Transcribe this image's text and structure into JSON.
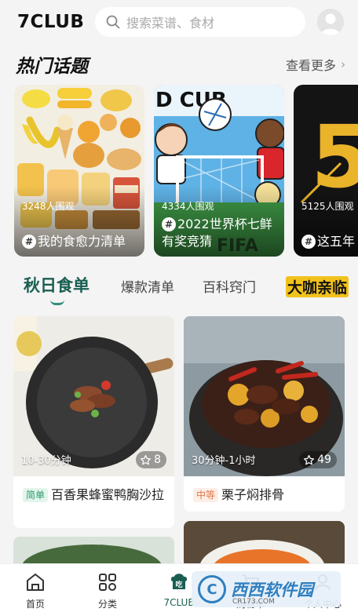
{
  "app": {
    "title": "7CLUB"
  },
  "search": {
    "placeholder": "搜索菜谱、食材"
  },
  "hot": {
    "title": "热门话题",
    "see_more": "查看更多",
    "topics": [
      {
        "views": "3248人围观",
        "title": "我的食愈力清单"
      },
      {
        "views": "4334人围观",
        "title": "2022世界杯七鲜有奖竞猜"
      },
      {
        "views": "5125人围观",
        "title": "这五年"
      }
    ]
  },
  "tabs": [
    {
      "label": "秋日食单"
    },
    {
      "label": "爆款清单"
    },
    {
      "label": "百科窍门"
    },
    {
      "label": "大咖亲临"
    }
  ],
  "recipes": [
    {
      "duration": "10-30分钟",
      "favorites": "8",
      "level": "简单",
      "name": "百香果蜂蜜鸭胸沙拉"
    },
    {
      "duration": "30分钟-1小时",
      "favorites": "49",
      "level": "中等",
      "name": "栗子焖排骨"
    }
  ],
  "nav": [
    {
      "label": "首页",
      "icon": "home-icon"
    },
    {
      "label": "分类",
      "icon": "category-grid-icon"
    },
    {
      "label": "7CLUB",
      "icon": "chef-hat-icon"
    },
    {
      "label": "购物车",
      "icon": "cart-icon"
    },
    {
      "label": "个人中心",
      "icon": "user-icon"
    }
  ],
  "watermark": {
    "text": "西西软件园",
    "sub": "CR173.COM"
  },
  "colors": {
    "accent": "#1a5e52",
    "accent_light": "#2f8e7a",
    "background": "#f4f4f4"
  }
}
